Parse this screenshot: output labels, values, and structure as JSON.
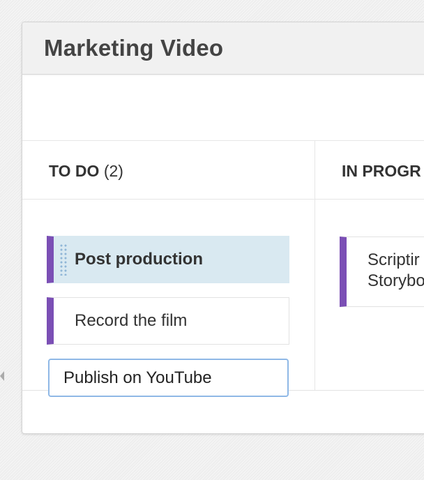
{
  "board": {
    "title": "Marketing Video"
  },
  "columns": [
    {
      "name": "TO DO",
      "count": "(2)",
      "cards": [
        {
          "label": "Post production",
          "state": "dragging"
        },
        {
          "label": "Record the film",
          "state": "normal"
        }
      ],
      "new_card_input": {
        "value": "Publish on YouTube"
      }
    },
    {
      "name": "IN PROGR",
      "cards": [
        {
          "label_line1": "Scriptir",
          "label_line2": "Storybo"
        }
      ]
    }
  ],
  "colors": {
    "card_accent": "#7b4fb5",
    "active_card_bg": "#d9e9f1",
    "input_focus_border": "#8fb8e6"
  },
  "icons": {
    "drag_handle": "drag-handle-icon"
  }
}
